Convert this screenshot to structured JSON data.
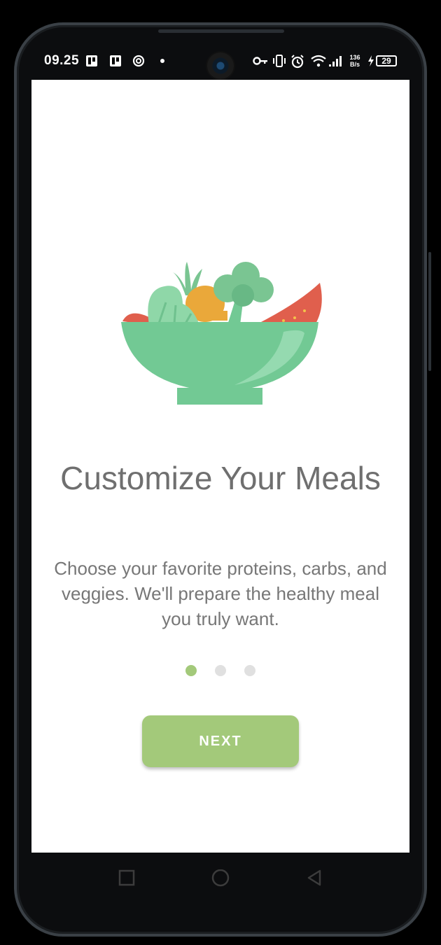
{
  "status_bar": {
    "time": "09.25",
    "net_speed_value": "136",
    "net_speed_unit": "B/s",
    "battery": "29",
    "icons": [
      "app-notification-icon",
      "app-notification-icon",
      "sync-icon",
      "dot-icon",
      "vpn-key-icon",
      "vibrate-icon",
      "alarm-icon",
      "wifi-icon",
      "signal-icon",
      "charging-icon",
      "battery-icon"
    ]
  },
  "onboarding": {
    "title": "Customize Your Meals",
    "description": "Choose your favorite proteins, carbs, and veggies. We'll prepare the healthy meal you truly want.",
    "current_page": 1,
    "total_pages": 3,
    "next_label": "NEXT"
  },
  "colors": {
    "accent": "#a3c97a",
    "bowl": "#72c994",
    "text": "#6f6f6f"
  },
  "nav_bar": {
    "icons": [
      "recents-square-icon",
      "home-circle-icon",
      "back-triangle-icon"
    ]
  }
}
